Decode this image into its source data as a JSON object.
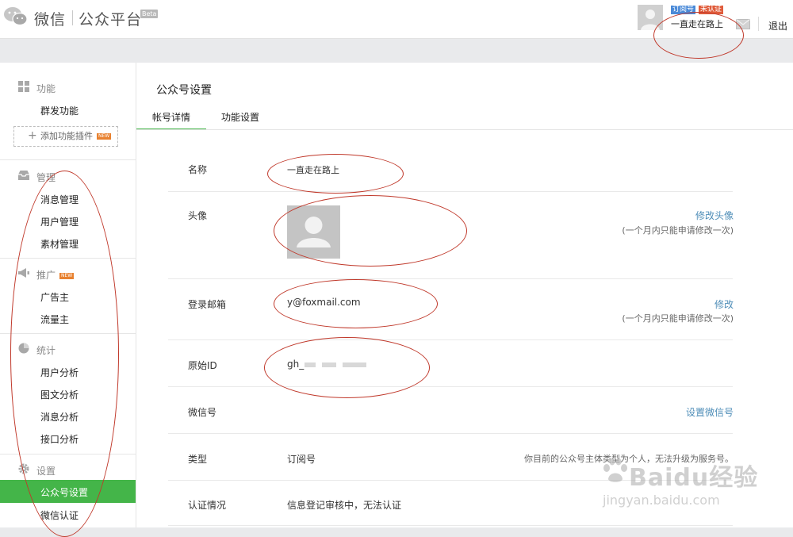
{
  "header": {
    "brand": "微信",
    "platform": "公众平台",
    "beta": "Beta",
    "tag_subscribe": "订阅号",
    "tag_unverified": "未认证",
    "username": "一直走在路上",
    "logout": "退出"
  },
  "sidebar": {
    "sections": [
      {
        "title": "功能",
        "icon": "grid-icon",
        "items": [
          "群发功能"
        ]
      },
      {
        "title": "管理",
        "icon": "inbox-icon",
        "items": [
          "消息管理",
          "用户管理",
          "素材管理"
        ]
      },
      {
        "title": "推广",
        "icon": "megaphone-icon",
        "badge": "NEW",
        "items": [
          "广告主",
          "流量主"
        ]
      },
      {
        "title": "统计",
        "icon": "pie-chart-icon",
        "items": [
          "用户分析",
          "图文分析",
          "消息分析",
          "接口分析"
        ]
      },
      {
        "title": "设置",
        "icon": "gear-icon",
        "items": [
          "公众号设置",
          "微信认证"
        ]
      }
    ],
    "add_plugin": "添加功能插件",
    "add_plugin_badge": "NEW",
    "active_item": "公众号设置"
  },
  "main": {
    "title": "公众号设置",
    "tabs": [
      "帐号详情",
      "功能设置"
    ],
    "active_tab": "帐号详情",
    "rows": {
      "name": {
        "label": "名称",
        "value": "一直走在路上"
      },
      "avatar": {
        "label": "头像",
        "link": "修改头像",
        "note": "(一个月内只能申请修改一次)"
      },
      "email": {
        "label": "登录邮箱",
        "value": "y@foxmail.com",
        "link": "修改",
        "note": "(一个月内只能申请修改一次)"
      },
      "original_id": {
        "label": "原始ID",
        "value": "gh_"
      },
      "wechat_id": {
        "label": "微信号",
        "link": "设置微信号"
      },
      "type": {
        "label": "类型",
        "value": "订阅号",
        "note": "你目前的公众号主体类型为个人，无法升级为服务号。"
      },
      "verification": {
        "label": "认证情况",
        "value": "信息登记审核中，无法认证"
      }
    }
  },
  "watermark": {
    "logo": "Baidu经验",
    "url": "jingyan.baidu.com"
  },
  "colors": {
    "accent_green": "#44b549",
    "link_blue": "#4f8eb8",
    "annotation_red": "#c0392b"
  }
}
